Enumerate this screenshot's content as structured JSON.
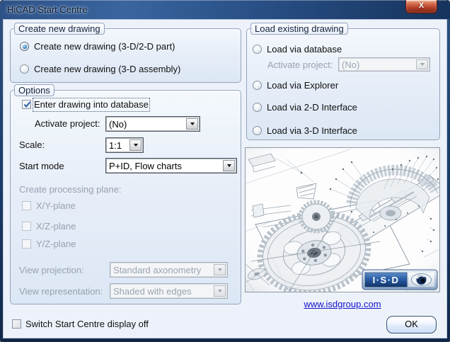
{
  "window": {
    "title": "HiCAD Start Centre",
    "close_glyph": "X"
  },
  "create_group": {
    "label": "Create new drawing",
    "radio_part": "Create new drawing (3-D/2-D part)",
    "radio_assembly": "Create new drawing (3-D assembly)"
  },
  "options_group": {
    "label": "Options",
    "enter_db": "Enter drawing into database",
    "activate_project_label": "Activate project:",
    "activate_project_value": "(No)",
    "scale_label": "Scale:",
    "scale_value": "1:1",
    "start_mode_label": "Start mode",
    "start_mode_value": "P+ID, Flow charts",
    "processing_plane_label": "Create processing plane:",
    "plane_xy": "X/Y-plane",
    "plane_xz": "X/Z-plane",
    "plane_yz": "Y/Z-plane",
    "view_projection_label": "View projection:",
    "view_projection_value": "Standard axonometry",
    "view_representation_label": "View representation:",
    "view_representation_value": "Shaded with edges"
  },
  "load_group": {
    "label": "Load existing drawing",
    "radio_database": "Load via database",
    "activate_project_label": "Activate project:",
    "activate_project_value": "(No)",
    "radio_explorer": "Load via Explorer",
    "radio_2d": "Load via 2-D Interface",
    "radio_3d": "Load via 3-D Interface"
  },
  "branding": {
    "logo_text": "I·S·D",
    "website_link": "www.isdgroup.com"
  },
  "footer": {
    "switch_off": "Switch Start Centre display off",
    "ok": "OK"
  },
  "colors": {
    "titlebar_blue": "#2a5188",
    "close_red": "#c25035",
    "link_blue": "#1212cc",
    "logo_blue": "#2a5ea6",
    "radio_accent": "#1a5c9c"
  }
}
